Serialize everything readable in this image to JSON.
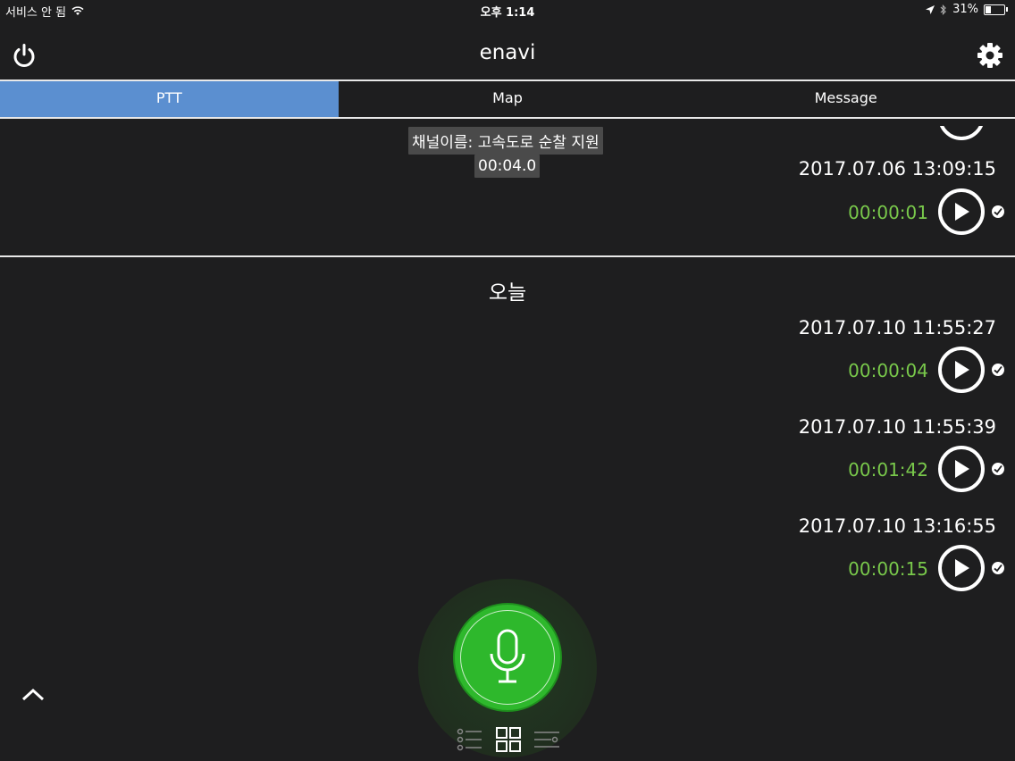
{
  "status_bar": {
    "carrier": "서비스 안 됨",
    "time": "오후 1:14",
    "battery": "31%",
    "battery_level": 0.31,
    "icons": [
      "wifi-icon",
      "location-arrow-icon",
      "bluetooth-icon",
      "battery-icon"
    ]
  },
  "header": {
    "title": "enavi",
    "left_icon": "power-icon",
    "right_icon": "gear-icon"
  },
  "tabs": [
    {
      "label": "PTT",
      "active": true
    },
    {
      "label": "Map",
      "active": false
    },
    {
      "label": "Message",
      "active": false
    }
  ],
  "tooltip": {
    "channel": "채널이름: 고속도로 순찰 지원",
    "elapsed": "00:04.0"
  },
  "earlier_records": [
    {
      "date": "2017.07.06  13:09:15",
      "duration": "00:00:01"
    }
  ],
  "day_label": "오늘",
  "today_records": [
    {
      "date": "2017.07.10  11:55:27",
      "duration": "00:00:04"
    },
    {
      "date": "2017.07.10  11:55:39",
      "duration": "00:01:42"
    },
    {
      "date": "2017.07.10  13:16:55",
      "duration": "00:00:15"
    }
  ],
  "colors": {
    "background": "#1e1e1f",
    "tab_active": "#5b8fd0",
    "duration_text": "#79c94b",
    "mic_button": "#2eb82c"
  },
  "bottom": {
    "mic_icon": "microphone-icon",
    "view_icons": [
      "list-view-icon",
      "grid-view-icon",
      "slider-view-icon"
    ],
    "active_view": "grid-view-icon"
  }
}
